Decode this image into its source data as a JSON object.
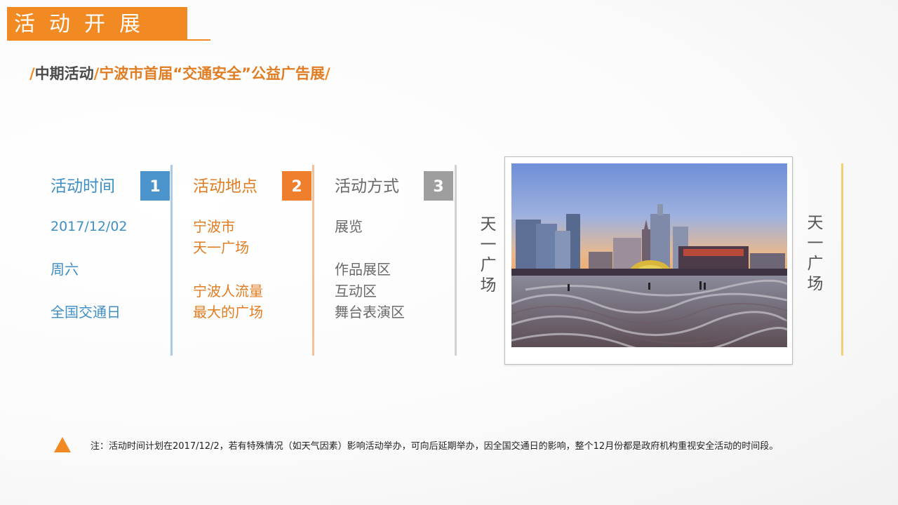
{
  "header": {
    "title": "活动开展",
    "subtitle_slash": "/",
    "subtitle_part1": "中期活动",
    "subtitle_part2": "宁波市首届“交通安全”公益广告展"
  },
  "columns": [
    {
      "title": "活动时间",
      "number": "1",
      "color": "#4b94cc",
      "items": [
        "2017/12/02",
        "周六",
        "全国交通日"
      ]
    },
    {
      "title": "活动地点",
      "number": "2",
      "color": "#ef7f2d",
      "items": [
        "宁波市",
        "天一广场",
        "宁波人流量",
        "最大的广场"
      ]
    },
    {
      "title": "活动方式",
      "number": "3",
      "color": "#9e9e9e",
      "items": [
        "展览",
        "作品展区",
        "互动区",
        "舞台表演区"
      ]
    }
  ],
  "photo": {
    "caption_left": "天一广场",
    "caption_right": "天一广场",
    "description": "天一广场夜景照片"
  },
  "note": {
    "text": "注：活动时间计划在2017/12/2，若有特殊情况（如天气因素）影响活动举办，可向后延期举办，因全国交通日的影响，整个12月份都是政府机构重视安全活动的时间段。",
    "icon": "triangle-warning-icon"
  },
  "colors": {
    "accent": "#f28a24",
    "blue": "#3f8fc5",
    "divider_blue": "#a9cbe6",
    "divider_orange": "#f2c19a",
    "divider_gray": "#d2d2d2",
    "yellow": "#f6d06e"
  }
}
